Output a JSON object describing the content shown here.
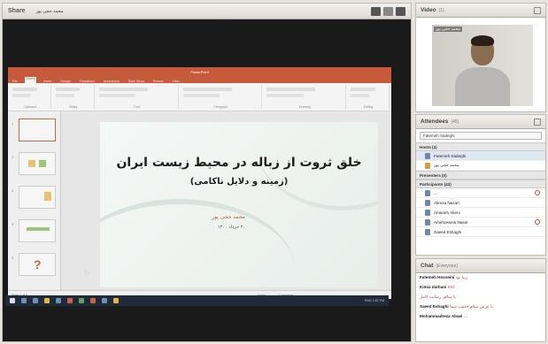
{
  "share": {
    "title": "Share",
    "presenter": "محمد حجی پور"
  },
  "powerpoint": {
    "title_text": "PowerPoint",
    "tabs": [
      "File",
      "Home",
      "Insert",
      "Design",
      "Transitions",
      "Animations",
      "Slide Show",
      "Review",
      "View"
    ],
    "ribbon_groups": [
      "Clipboard",
      "Slides",
      "Font",
      "Paragraph",
      "Drawing",
      "Editing"
    ],
    "slide_numbers": [
      "1",
      "2",
      "3",
      "4",
      "5"
    ],
    "slide": {
      "title": "خلق ثروت از زباله در محیط زیست ایران",
      "subtitle": "(زمینه و دلایل ناکامی)",
      "author": "محمد حجی پور",
      "date": "۲۰ خرداد ۱۴۰۰"
    },
    "status_left": "Slide 1 of 5",
    "status_notes": "Notes",
    "status_comments": "Comments"
  },
  "taskbar": {
    "tray": "ENG  1:52 PM"
  },
  "video": {
    "title": "Video",
    "count": "(1)",
    "name_tag": "محمد حجی پور"
  },
  "attendees": {
    "title": "Attendees",
    "count": "(45)",
    "search_value": "Fatemeh Sadeghi",
    "hosts_label": "Hosts (2)",
    "hosts": [
      "Fatemeh Sadeghi",
      "محمد حجی پور"
    ],
    "presenters_label": "Presenters (0)",
    "participants_label": "Participants (43)",
    "participants": [
      "...",
      "Alireza Nazari",
      "Amaneh Akeni",
      "Amirhossein Nasiri",
      "Saeed Eshaghi"
    ]
  },
  "chat": {
    "title": "Chat",
    "scope": "(Everyone)",
    "messages": [
      {
        "who": "Fatemeh Hosseini",
        "text": "زیبا بود"
      },
      {
        "who": "Kimia darbani",
        "text": "mic"
      },
      {
        "who": "",
        "text": "با سلام. رضایت کامل"
      },
      {
        "who": "Saeed Eshaghi",
        "text": "با عرض سلام خدمت شما"
      },
      {
        "who": "Mohammadreza Abaei",
        "text": "..."
      }
    ]
  },
  "colors": {
    "ppt_accent": "#c65b3b",
    "chat_text": "#c03a3a"
  }
}
